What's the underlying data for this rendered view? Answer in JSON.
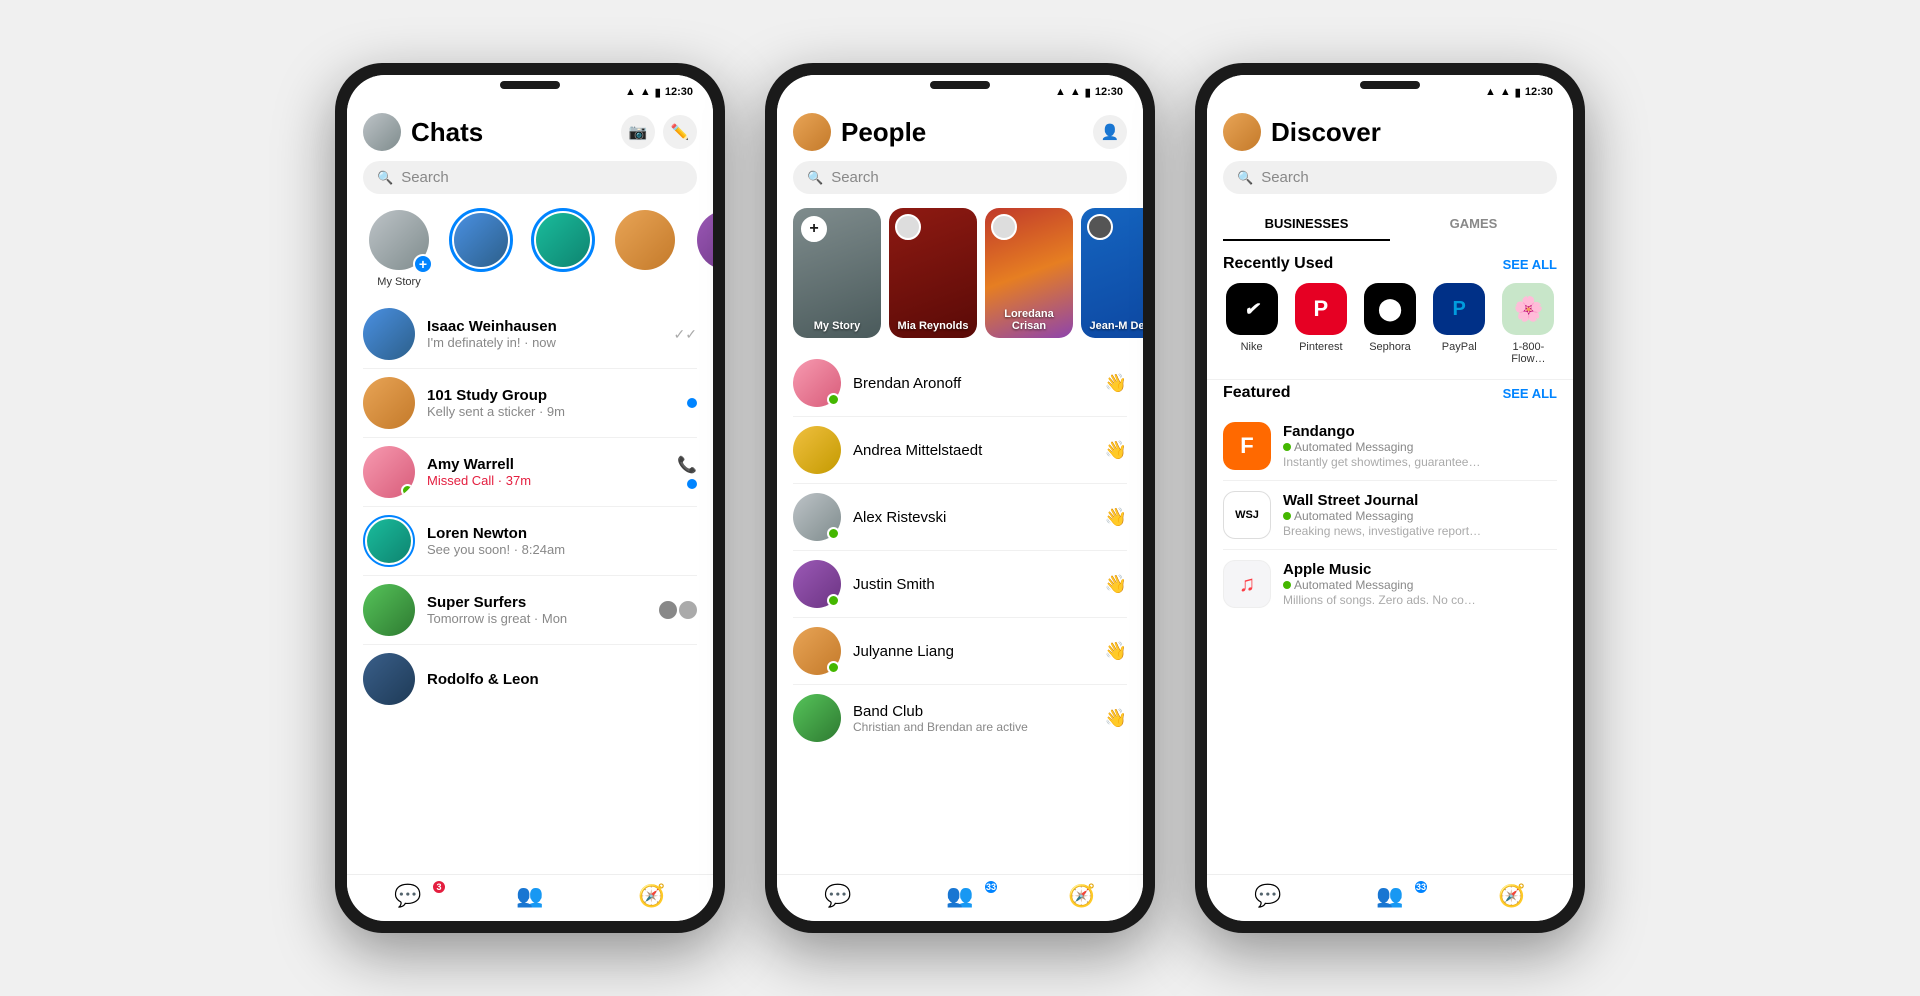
{
  "phones": [
    {
      "id": "chats",
      "header": {
        "title": "Chats",
        "camera_label": "📷",
        "compose_label": "✏️"
      },
      "search": {
        "placeholder": "Search"
      },
      "stories": [
        {
          "id": "my-story",
          "label": "My Story",
          "has_add": true,
          "ring": false,
          "color": "av-gray"
        },
        {
          "id": "story2",
          "label": "",
          "ring": true,
          "color": "av-blue"
        },
        {
          "id": "story3",
          "label": "",
          "ring": true,
          "color": "av-teal"
        },
        {
          "id": "story4",
          "label": "",
          "ring": false,
          "color": "av-orange"
        },
        {
          "id": "story5",
          "label": "",
          "ring": false,
          "color": "av-purple"
        }
      ],
      "chats": [
        {
          "id": "isaac",
          "name": "Isaac Weinhausen",
          "preview": "I'm definately in! · now",
          "meta": "check",
          "online": false,
          "color": "av-blue"
        },
        {
          "id": "study",
          "name": "101 Study Group",
          "preview": "Kelly sent a sticker · 9m",
          "meta": "unread",
          "online": false,
          "color": "av-orange"
        },
        {
          "id": "amy",
          "name": "Amy Warrell",
          "preview": "Missed Call · 37m",
          "meta": "phone-unread",
          "missed": true,
          "online": true,
          "color": "av-pink"
        },
        {
          "id": "loren",
          "name": "Loren Newton",
          "preview": "See you soon! · 8:24am",
          "meta": "none",
          "online": false,
          "color": "av-teal",
          "ring": true
        },
        {
          "id": "surfers",
          "name": "Super Surfers",
          "preview": "Tomorrow is great · Mon",
          "meta": "group",
          "online": false,
          "color": "av-green"
        },
        {
          "id": "rodolfo",
          "name": "Rodolfo & Leon",
          "preview": "",
          "meta": "none",
          "online": false,
          "color": "av-navy"
        }
      ],
      "nav": {
        "items": [
          {
            "id": "chat",
            "icon": "💬",
            "active": true,
            "badge": "3",
            "badge_type": "red"
          },
          {
            "id": "people",
            "icon": "👥",
            "active": false
          },
          {
            "id": "discover",
            "icon": "🧭",
            "active": false
          }
        ]
      }
    },
    {
      "id": "people",
      "header": {
        "title": "People",
        "add_label": "👤+"
      },
      "search": {
        "placeholder": "Search"
      },
      "story_cards": [
        {
          "id": "my-story",
          "label": "My Story",
          "type": "add",
          "color": "sc-gray"
        },
        {
          "id": "mia",
          "label": "Mia Reynolds",
          "color": "sc-gray"
        },
        {
          "id": "loredana",
          "label": "Loredana Crisan",
          "color": "sc-multi"
        },
        {
          "id": "jean",
          "label": "Jean-M Denis",
          "color": "sc-blue"
        }
      ],
      "contacts": [
        {
          "id": "brendan",
          "name": "Brendan Aronoff",
          "color": "av-pink"
        },
        {
          "id": "andrea",
          "name": "Andrea Mittelstaedt",
          "color": "av-yellow"
        },
        {
          "id": "alex",
          "name": "Alex Ristevski",
          "color": "av-gray"
        },
        {
          "id": "justin",
          "name": "Justin Smith",
          "color": "av-purple"
        },
        {
          "id": "julyanne",
          "name": "Julyanne Liang",
          "color": "av-orange"
        },
        {
          "id": "band",
          "name": "Band Club",
          "preview": "Christian and Brendan are active",
          "color": "av-green"
        }
      ],
      "nav": {
        "items": [
          {
            "id": "chat",
            "icon": "💬",
            "active": false
          },
          {
            "id": "people",
            "icon": "👥",
            "active": true,
            "badge": "33",
            "badge_type": "blue"
          },
          {
            "id": "discover",
            "icon": "🧭",
            "active": false
          }
        ]
      }
    },
    {
      "id": "discover",
      "header": {
        "title": "Discover"
      },
      "search": {
        "placeholder": "Search"
      },
      "tabs": [
        {
          "id": "businesses",
          "label": "BUSINESSES",
          "active": true
        },
        {
          "id": "games",
          "label": "GAMES",
          "active": false
        }
      ],
      "recently_used": {
        "title": "Recently Used",
        "see_all": "SEE ALL",
        "items": [
          {
            "id": "nike",
            "name": "Nike",
            "bg": "#000",
            "text_color": "#fff",
            "symbol": "✔"
          },
          {
            "id": "pinterest",
            "name": "Pinterest",
            "bg": "#e60023",
            "text_color": "#fff",
            "symbol": "P"
          },
          {
            "id": "sephora",
            "name": "Sephora",
            "bg": "#000",
            "text_color": "#fff",
            "symbol": "⬤"
          },
          {
            "id": "paypal",
            "name": "PayPal",
            "bg": "#003087",
            "text_color": "#fff",
            "symbol": "P"
          },
          {
            "id": "flowers",
            "name": "1-800-Flow…",
            "bg": "#c8e6c9",
            "text_color": "#2e7d32",
            "symbol": "🌸"
          }
        ]
      },
      "featured": {
        "title": "Featured",
        "see_all": "SEE ALL",
        "items": [
          {
            "id": "fandango",
            "name": "Fandango",
            "sub": "Automated Messaging",
            "desc": "Instantly get showtimes, guarantee tick…",
            "bg": "#ff6900",
            "symbol": "F",
            "text_color": "#fff"
          },
          {
            "id": "wsj",
            "name": "Wall Street Journal",
            "sub": "Automated Messaging",
            "desc": "Breaking news, investigative reporting…",
            "bg": "#fff",
            "symbol": "WSJ",
            "text_color": "#000",
            "border": true
          },
          {
            "id": "apple-music",
            "name": "Apple Music",
            "sub": "Automated Messaging",
            "desc": "Millions of songs. Zero ads. No commitment…",
            "bg": "#f5f5f7",
            "symbol": "♫",
            "symbol_color": "#fc3c44",
            "text_color": "#fc3c44"
          }
        ]
      },
      "nav": {
        "items": [
          {
            "id": "chat",
            "icon": "💬",
            "active": false
          },
          {
            "id": "people",
            "icon": "👥",
            "active": false,
            "badge": "33",
            "badge_type": "blue"
          },
          {
            "id": "discover",
            "icon": "🧭",
            "active": true
          }
        ]
      }
    }
  ],
  "status_bar": {
    "time": "12:30"
  }
}
